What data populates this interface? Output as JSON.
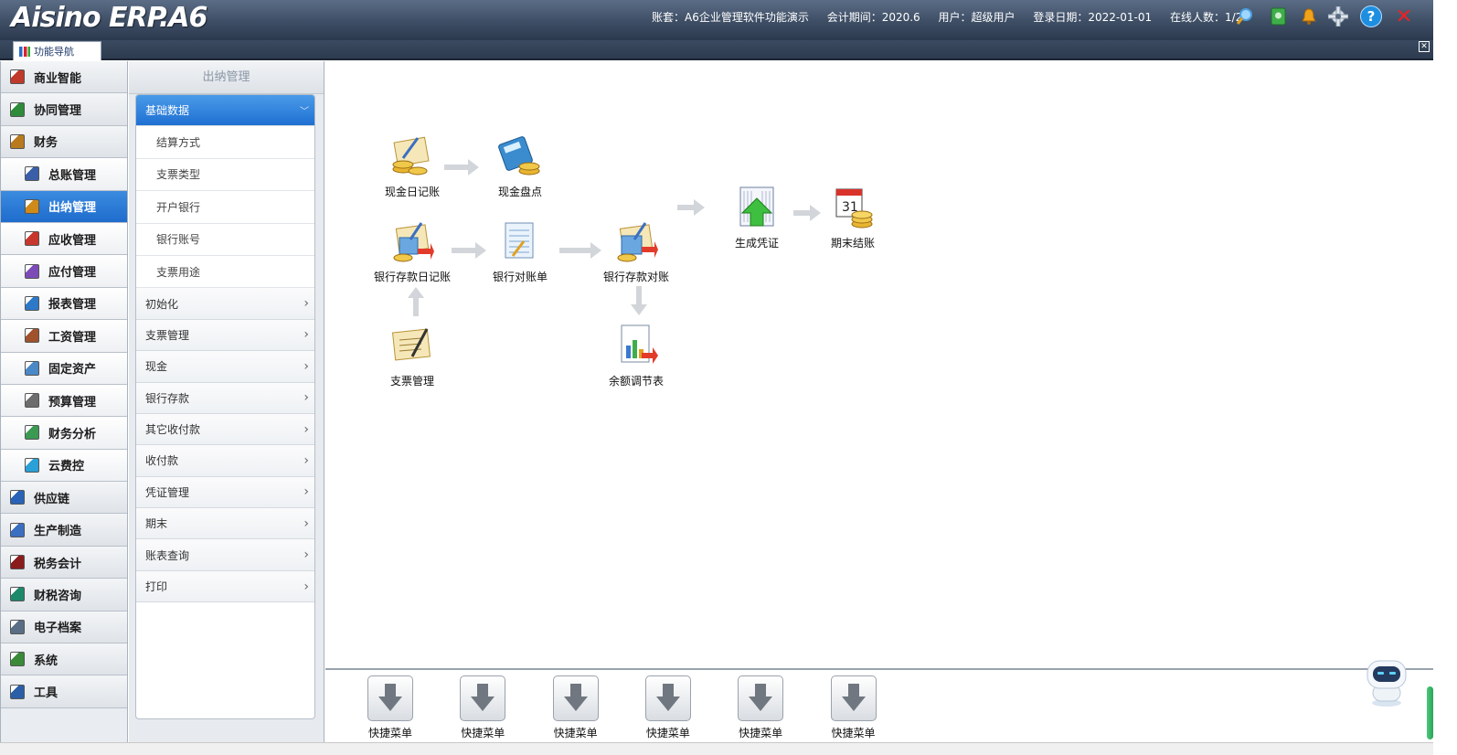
{
  "app": {
    "logo": "Aisino ERP.A6",
    "info": {
      "account": "账套：A6企业管理软件功能演示",
      "period": "会计期间：2020.6",
      "user": "用户：超级用户",
      "login_date": "登录日期：2022-01-01",
      "online": "在线人数：1/2"
    },
    "toolbar_icons": [
      "search-icon",
      "address-book-icon",
      "bell-icon",
      "gear-icon",
      "help-icon",
      "close-icon"
    ]
  },
  "tabs": {
    "nav": "功能导航"
  },
  "left_menu": [
    {
      "label": "商业智能",
      "level": "top",
      "color": "#c0392b"
    },
    {
      "label": "协同管理",
      "level": "top",
      "color": "#2e8b3a"
    },
    {
      "label": "财务",
      "level": "top",
      "color": "#b97a1e"
    },
    {
      "label": "总账管理",
      "level": "sub",
      "color": "#3a5fa8"
    },
    {
      "label": "出纳管理",
      "level": "sub",
      "color": "#d08a1a",
      "active": true
    },
    {
      "label": "应收管理",
      "level": "sub",
      "color": "#c8372d"
    },
    {
      "label": "应付管理",
      "level": "sub",
      "color": "#7d4bb8"
    },
    {
      "label": "报表管理",
      "level": "sub",
      "color": "#2d79c8"
    },
    {
      "label": "工资管理",
      "level": "sub",
      "color": "#a0522d"
    },
    {
      "label": "固定资产",
      "level": "sub",
      "color": "#4b88c7"
    },
    {
      "label": "预算管理",
      "level": "sub",
      "color": "#6d6d6d"
    },
    {
      "label": "财务分析",
      "level": "sub",
      "color": "#3a9a52"
    },
    {
      "label": "云费控",
      "level": "sub",
      "color": "#2aa0d8"
    },
    {
      "label": "供应链",
      "level": "top",
      "color": "#2a62b8"
    },
    {
      "label": "生产制造",
      "level": "top",
      "color": "#3a6fc2"
    },
    {
      "label": "税务会计",
      "level": "top",
      "color": "#8a1c1c"
    },
    {
      "label": "财税咨询",
      "level": "top",
      "color": "#1c8a6a"
    },
    {
      "label": "电子档案",
      "level": "top",
      "color": "#5a6e86"
    },
    {
      "label": "系统",
      "level": "top",
      "color": "#3a8a3a"
    },
    {
      "label": "工具",
      "level": "top",
      "color": "#2a5fa8"
    }
  ],
  "mid": {
    "header": "出纳管理",
    "groups": [
      {
        "label": "基础数据",
        "open": true,
        "items": [
          "结算方式",
          "支票类型",
          "开户银行",
          "银行账号",
          "支票用途"
        ]
      },
      {
        "label": "初始化"
      },
      {
        "label": "支票管理"
      },
      {
        "label": "现金"
      },
      {
        "label": "银行存款"
      },
      {
        "label": "其它收付款"
      },
      {
        "label": "收付款"
      },
      {
        "label": "凭证管理"
      },
      {
        "label": "期末"
      },
      {
        "label": "账表查询"
      },
      {
        "label": "打印"
      }
    ]
  },
  "flow": {
    "cash_journal": "现金日记账",
    "cash_count": "现金盘点",
    "bank_journal": "银行存款日记账",
    "bank_statement": "银行对账单",
    "bank_reconcile": "银行存款对账",
    "gen_voucher": "生成凭证",
    "period_close": "期末结账",
    "cheque_mgmt": "支票管理",
    "balance_table": "余额调节表"
  },
  "shortcuts": [
    "快捷菜单",
    "快捷菜单",
    "快捷菜单",
    "快捷菜单",
    "快捷菜单",
    "快捷菜单"
  ]
}
